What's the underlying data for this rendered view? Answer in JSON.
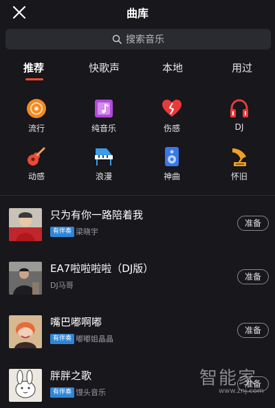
{
  "header": {
    "title": "曲库",
    "close_icon": "close-icon"
  },
  "search": {
    "placeholder": "搜索音乐",
    "icon": "search-icon"
  },
  "tabs": [
    {
      "label": "推荐",
      "active": true
    },
    {
      "label": "快歌声",
      "active": false
    },
    {
      "label": "本地",
      "active": false
    },
    {
      "label": "用过",
      "active": false
    }
  ],
  "accent_color": "#ff4a2f",
  "categories": [
    {
      "label": "流行",
      "icon": "disc-icon",
      "color": "#f08a24"
    },
    {
      "label": "纯音乐",
      "icon": "music-note-icon",
      "color": "#b04ad8"
    },
    {
      "label": "伤感",
      "icon": "broken-heart-icon",
      "color": "#e83a3a"
    },
    {
      "label": "DJ",
      "icon": "headphones-icon",
      "color": "#e83a3a"
    },
    {
      "label": "动感",
      "icon": "guitar-icon",
      "color": "#e84a3a"
    },
    {
      "label": "浪漫",
      "icon": "piano-icon",
      "color": "#3a9be8"
    },
    {
      "label": "神曲",
      "icon": "speaker-icon",
      "color": "#3a78e8"
    },
    {
      "label": "怀旧",
      "icon": "gramophone-icon",
      "color": "#f0a024"
    }
  ],
  "songs": [
    {
      "title": "只为有你一路陪着我",
      "badge": "有伴奏",
      "artist": "梁晓宇",
      "action": "准备"
    },
    {
      "title": "EA7啦啦啦啦（DJ版）",
      "badge": "",
      "artist": "DJ马哥",
      "action": "准备"
    },
    {
      "title": "嘴巴嘟啊嘟",
      "badge": "有伴奏",
      "artist": "嘟嘟姐晶晶",
      "action": "准备"
    },
    {
      "title": "胖胖之歌",
      "badge": "有伴奏",
      "artist": "馒头音乐",
      "action": "准备"
    }
  ],
  "watermark": {
    "text": "智能家",
    "url": "www.znj.com"
  }
}
